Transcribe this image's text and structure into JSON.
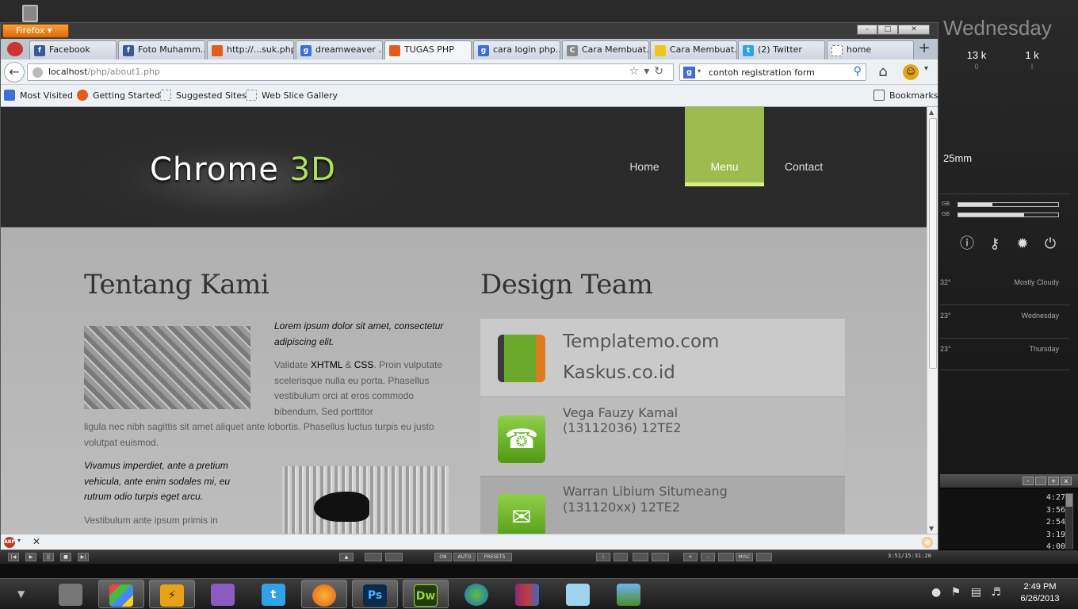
{
  "desktop": {
    "widget_day": "Wednesday",
    "stat1": {
      "value": "13 k",
      "sub": "0"
    },
    "stat2": {
      "value": "1 k",
      "sub": "I"
    },
    "lens_label": "25mm",
    "bar_labels": [
      "GB",
      "GB"
    ],
    "weather": [
      {
        "temp": "32°",
        "desc": "Mostly Cloudy"
      },
      {
        "temp": "23°",
        "desc": "Wednesday"
      },
      {
        "temp": "23°",
        "desc": "Thursday"
      }
    ],
    "media_times": [
      "4:27",
      "3:56",
      "2:54",
      "3:19",
      "4:00"
    ],
    "media_counter": "3:51/15:31:20",
    "media_buttons": [
      "ON",
      "AUTO",
      "PRESETS",
      "MISC"
    ]
  },
  "firefox": {
    "menu_label": "Firefox",
    "tabs": [
      {
        "label": "Facebook",
        "fav": "f",
        "color": "#3b5998"
      },
      {
        "label": "Foto Muhamm...",
        "fav": "f",
        "color": "#3b5998"
      },
      {
        "label": "http://...suk.php",
        "fav": "",
        "color": "#e25d1c"
      },
      {
        "label": "dreamweaver ...",
        "fav": "g",
        "color": "#3b6fd6"
      },
      {
        "label": "TUGAS PHP",
        "fav": "",
        "color": "#e25d1c"
      },
      {
        "label": "cara login php...",
        "fav": "g",
        "color": "#3b6fd6"
      },
      {
        "label": "Cara Membuat...",
        "fav": "C",
        "color": "#888888"
      },
      {
        "label": "Cara Membuat...",
        "fav": "",
        "color": "#f0c419"
      },
      {
        "label": "(2) Twitter",
        "fav": "t",
        "color": "#2fa3e6"
      },
      {
        "label": "home",
        "fav": "",
        "color": "#ffffff"
      }
    ],
    "url_host": "localhost",
    "url_path": "/php/about1.php",
    "search_query": "contoh registration form",
    "bookmarks": [
      "Most Visited",
      "Getting Started",
      "Suggested Sites",
      "Web Slice Gallery"
    ],
    "bookmarks_menu": "Bookmarks"
  },
  "site": {
    "logo_main": "Chrome",
    "logo_accent": "3D",
    "nav": [
      "Home",
      "Menu",
      "Contact"
    ],
    "about_title": "Tentang Kami",
    "about_lead": "Lorem ipsum dolor sit amet, consectetur adipiscing elit.",
    "validate_prefix": "Validate",
    "validate_xhtml": "XHTML",
    "validate_amp": "&",
    "validate_css": "CSS",
    "about_para_a": ". Proin vulputate scelerisque nulla eu porta. Phasellus vestibulum orci at eros commodo bibendum. Sed porttitor",
    "about_para_b": "ligula nec nibh sagittis sit amet aliquet ante lobortis. Phasellus luctus turpis eu justo volutpat euismod.",
    "about_quote": "Vivamus imperdiet, ante a pretium vehicula, ante enim sodales mi, eu rutrum odio turpis eget arcu.",
    "about_para_c": "Vestibulum ante ipsum primis in",
    "team_title": "Design Team",
    "team": [
      {
        "line1": "Templatemo.com",
        "line2": "Kaskus.co.id"
      },
      {
        "line1": "Vega Fauzy Kamal",
        "line2": "(13112036) 12TE2"
      },
      {
        "line1": "Warran Libium Situmeang",
        "line2": "(131120xx) 12TE2"
      }
    ]
  },
  "taskbar": {
    "apps": [
      "Windows Explorer",
      "Windows",
      "Winamp",
      "Pidgin",
      "Twitter",
      "Firefox",
      "Ps",
      "Dw",
      "Internet Download Manager",
      "WinRAR",
      "Notepad",
      "Pictures"
    ],
    "time": "2:49 PM",
    "date": "6/26/2013"
  }
}
